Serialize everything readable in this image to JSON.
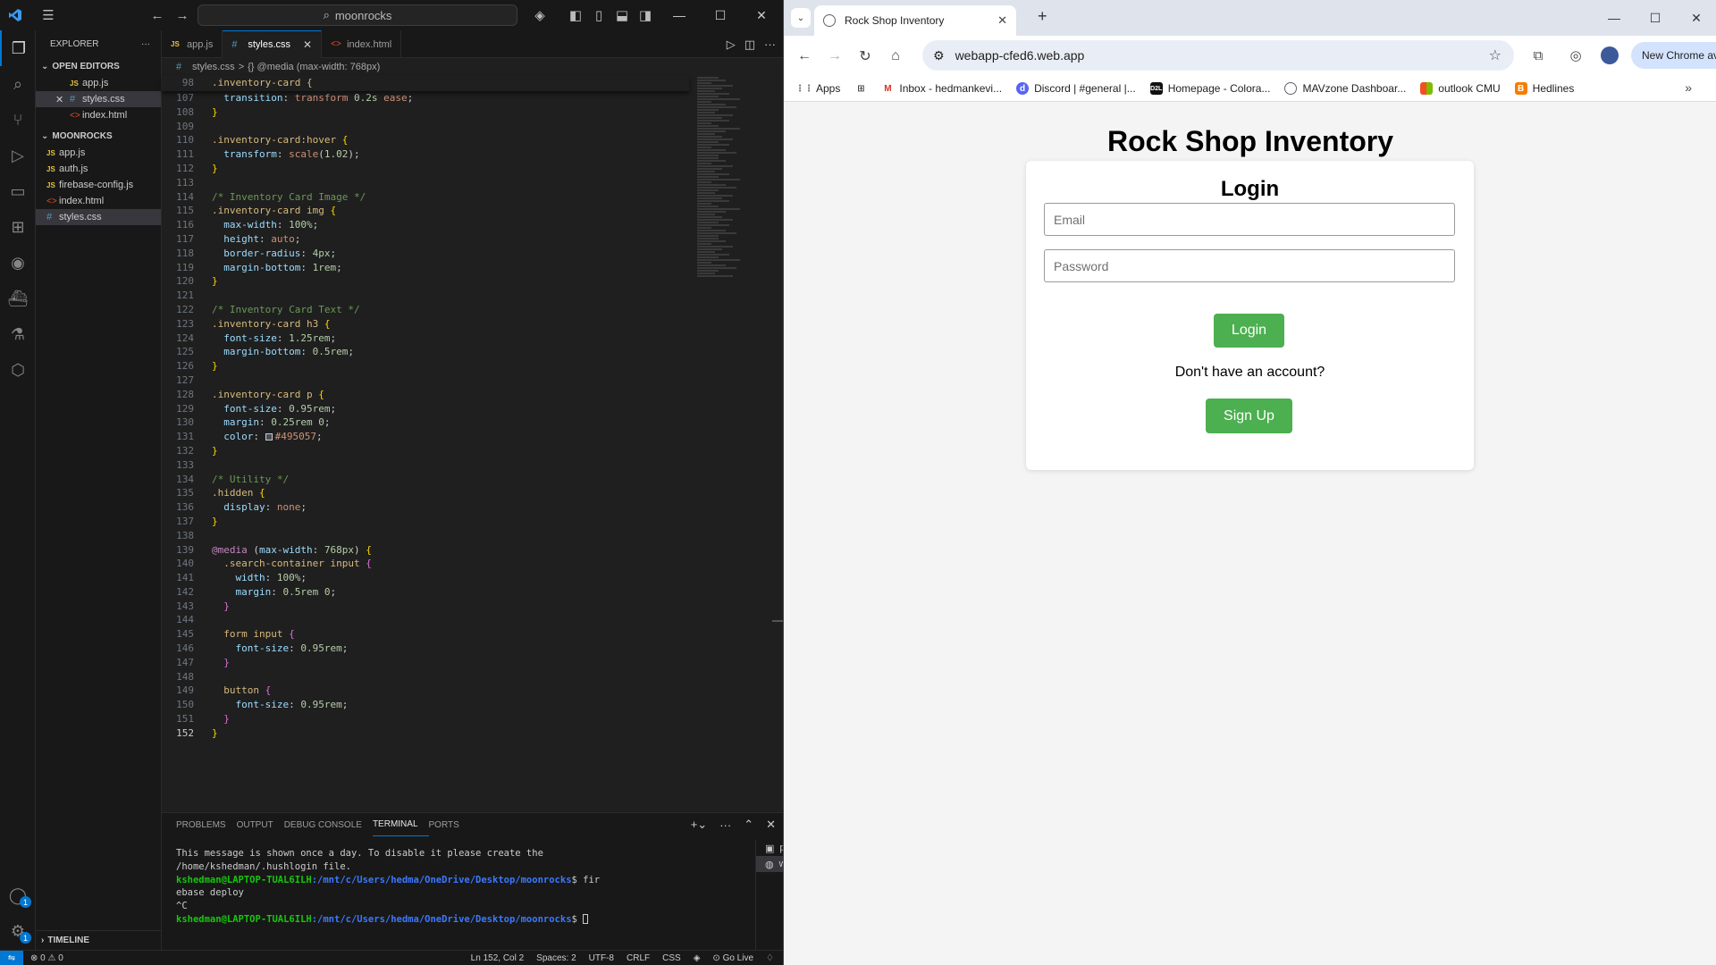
{
  "vscode": {
    "search_text": "moonrocks",
    "explorer_title": "EXPLORER",
    "open_editors_label": "OPEN EDITORS",
    "open_editors": [
      {
        "name": "app.js",
        "type": "js"
      },
      {
        "name": "styles.css",
        "type": "css"
      },
      {
        "name": "index.html",
        "type": "html"
      }
    ],
    "folder_label": "MOONROCKS",
    "files": [
      {
        "name": "app.js",
        "type": "js"
      },
      {
        "name": "auth.js",
        "type": "js"
      },
      {
        "name": "firebase-config.js",
        "type": "js"
      },
      {
        "name": "index.html",
        "type": "html"
      },
      {
        "name": "styles.css",
        "type": "css"
      }
    ],
    "timeline_label": "TIMELINE",
    "tabs": [
      {
        "label": "app.js",
        "type": "js"
      },
      {
        "label": "styles.css",
        "type": "css"
      },
      {
        "label": "index.html",
        "type": "html"
      }
    ],
    "breadcrumb": {
      "file": "styles.css",
      "sep": ">",
      "scope": "{} @media (max-width: 768px)"
    },
    "sticky_line": {
      "num": "98",
      "text": ".inventory-card {"
    },
    "code_lines": [
      {
        "num": "107",
        "html": "  <span class='prop'>transition</span>: <span class='val'>transform</span> <span class='num'>0.2s</span> <span class='val'>ease</span>;"
      },
      {
        "num": "108",
        "html": "<span class='brk1'>}</span>"
      },
      {
        "num": "109",
        "html": ""
      },
      {
        "num": "110",
        "html": "<span class='sel-c'>.inventory-card:hover</span> <span class='brk1'>{</span>"
      },
      {
        "num": "111",
        "html": "  <span class='prop'>transform</span>: <span class='val'>scale</span>(<span class='num'>1.02</span>);"
      },
      {
        "num": "112",
        "html": "<span class='brk1'>}</span>"
      },
      {
        "num": "113",
        "html": ""
      },
      {
        "num": "114",
        "html": "<span class='cmt'>/* Inventory Card Image */</span>"
      },
      {
        "num": "115",
        "html": "<span class='sel-c'>.inventory-card img</span> <span class='brk1'>{</span>"
      },
      {
        "num": "116",
        "html": "  <span class='prop'>max-width</span>: <span class='num'>100%</span>;"
      },
      {
        "num": "117",
        "html": "  <span class='prop'>height</span>: <span class='val'>auto</span>;"
      },
      {
        "num": "118",
        "html": "  <span class='prop'>border-radius</span>: <span class='num'>4px</span>;"
      },
      {
        "num": "119",
        "html": "  <span class='prop'>margin-bottom</span>: <span class='num'>1rem</span>;"
      },
      {
        "num": "120",
        "html": "<span class='brk1'>}</span>"
      },
      {
        "num": "121",
        "html": ""
      },
      {
        "num": "122",
        "html": "<span class='cmt'>/* Inventory Card Text */</span>"
      },
      {
        "num": "123",
        "html": "<span class='sel-c'>.inventory-card h3</span> <span class='brk1'>{</span>"
      },
      {
        "num": "124",
        "html": "  <span class='prop'>font-size</span>: <span class='num'>1.25rem</span>;"
      },
      {
        "num": "125",
        "html": "  <span class='prop'>margin-bottom</span>: <span class='num'>0.5rem</span>;"
      },
      {
        "num": "126",
        "html": "<span class='brk1'>}</span>"
      },
      {
        "num": "127",
        "html": ""
      },
      {
        "num": "128",
        "html": "<span class='sel-c'>.inventory-card p</span> <span class='brk1'>{</span>"
      },
      {
        "num": "129",
        "html": "  <span class='prop'>font-size</span>: <span class='num'>0.95rem</span>;"
      },
      {
        "num": "130",
        "html": "  <span class='prop'>margin</span>: <span class='num'>0.25rem</span> <span class='num'>0</span>;"
      },
      {
        "num": "131",
        "html": "  <span class='prop'>color</span>: <span class='swatch'></span><span class='val'>#495057</span>;"
      },
      {
        "num": "132",
        "html": "<span class='brk1'>}</span>"
      },
      {
        "num": "133",
        "html": ""
      },
      {
        "num": "134",
        "html": "<span class='cmt'>/* Utility */</span>"
      },
      {
        "num": "135",
        "html": "<span class='sel-c'>.hidden</span> <span class='brk1'>{</span>"
      },
      {
        "num": "136",
        "html": "  <span class='prop'>display</span>: <span class='val'>none</span>;"
      },
      {
        "num": "137",
        "html": "<span class='brk1'>}</span>"
      },
      {
        "num": "138",
        "html": ""
      },
      {
        "num": "139",
        "html": "<span class='at'>@media</span> (<span class='prop'>max-width</span>: <span class='num'>768px</span>) <span class='brk1'>{</span>"
      },
      {
        "num": "140",
        "html": "  <span class='sel-c'>.search-container input</span> <span class='brk2'>{</span>"
      },
      {
        "num": "141",
        "html": "    <span class='prop'>width</span>: <span class='num'>100%</span>;"
      },
      {
        "num": "142",
        "html": "    <span class='prop'>margin</span>: <span class='num'>0.5rem</span> <span class='num'>0</span>;"
      },
      {
        "num": "143",
        "html": "  <span class='brk2'>}</span>"
      },
      {
        "num": "144",
        "html": ""
      },
      {
        "num": "145",
        "html": "  <span class='sel-c'>form input</span> <span class='brk2'>{</span>"
      },
      {
        "num": "146",
        "html": "    <span class='prop'>font-size</span>: <span class='num'>0.95rem</span>;"
      },
      {
        "num": "147",
        "html": "  <span class='brk2'>}</span>"
      },
      {
        "num": "148",
        "html": ""
      },
      {
        "num": "149",
        "html": "  <span class='sel-c'>button</span> <span class='brk2'>{</span>"
      },
      {
        "num": "150",
        "html": "    <span class='prop'>font-size</span>: <span class='num'>0.95rem</span>;"
      },
      {
        "num": "151",
        "html": "  <span class='brk2'>}</span>"
      },
      {
        "num": "152",
        "html": "<span class='brk1'>}</span>"
      }
    ],
    "current_line": "152",
    "panel_tabs": [
      "PROBLEMS",
      "OUTPUT",
      "DEBUG CONSOLE",
      "TERMINAL",
      "PORTS"
    ],
    "active_panel_tab": "TERMINAL",
    "terminal": {
      "msg1": "This message is shown once a day. To disable it please create the",
      "msg2": "/home/kshedman/.hushlogin file.",
      "user": "kshedman@LAPTOP-TUAL6ILH",
      "path": ":/mnt/c/Users/hedma/OneDrive/Desktop/moonrocks",
      "cmd1": "$ fir",
      "cmd1b": "ebase deploy",
      "ctrl_c": "^C",
      "prompt2_suffix": "$ "
    },
    "terminal_list": [
      {
        "label": "powershell",
        "active": false
      },
      {
        "label": "wsl",
        "active": true
      }
    ],
    "status": {
      "errors": "0",
      "warnings": "0",
      "position": "Ln 152, Col 2",
      "spaces": "Spaces: 2",
      "encoding": "UTF-8",
      "eol": "CRLF",
      "language": "CSS",
      "go_live": "Go Live"
    },
    "badge_accounts": "1",
    "badge_settings": "1"
  },
  "chrome": {
    "tab_title": "Rock Shop Inventory",
    "url": "webapp-cfed6.web.app",
    "new_chrome_label": "New Chrome available",
    "bookmarks": [
      {
        "label": "Apps",
        "icon": "apps-grid-icon"
      },
      {
        "label": "",
        "icon": "tab-groups-icon"
      },
      {
        "label": "Inbox - hedmankevi...",
        "icon": "gmail-icon"
      },
      {
        "label": "Discord | #general |...",
        "icon": "discord-icon"
      },
      {
        "label": "Homepage - Colora...",
        "icon": "d2l-icon"
      },
      {
        "label": "MAVzone Dashboar...",
        "icon": "globe-icon"
      },
      {
        "label": "outlook CMU",
        "icon": "microsoft-icon"
      },
      {
        "label": "Hedlines",
        "icon": "blogger-icon"
      }
    ]
  },
  "page": {
    "title": "Rock Shop Inventory",
    "login_heading": "Login",
    "email_placeholder": "Email",
    "password_placeholder": "Password",
    "login_button": "Login",
    "no_account_text": "Don't have an account?",
    "signup_button": "Sign Up",
    "accent_color": "#4caf50"
  }
}
